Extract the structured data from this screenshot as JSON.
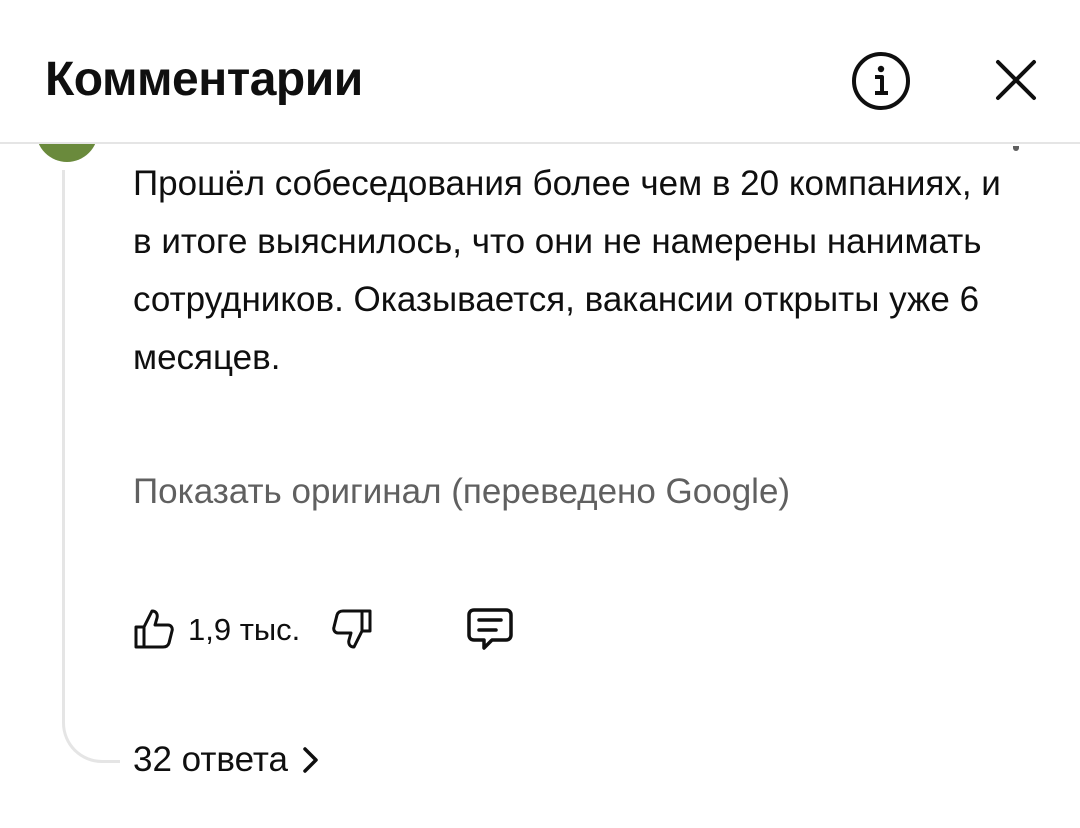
{
  "header": {
    "title": "Комментарии",
    "info_icon": "info-circle-icon",
    "close_icon": "close-x-icon"
  },
  "comment": {
    "text": "Прошёл собеседования более чем в 20 компаниях, и в итоге выяснилось, что они не намерены нанимать сотрудников. Оказывается, вакансии открыты уже 6 месяцев.",
    "show_original": "Показать оригинал (переведено Google)",
    "likes": "1,9 тыс.",
    "replies": "32 ответа"
  },
  "colors": {
    "text_primary": "#0f0f0f",
    "text_secondary": "#606060",
    "divider": "#e5e5e5",
    "avatar": "#6a8a3c"
  }
}
